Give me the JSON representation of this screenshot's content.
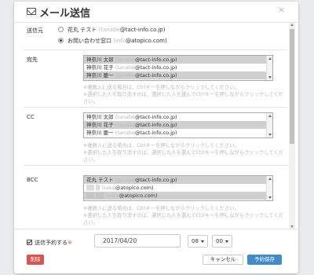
{
  "header": {
    "title": "メール送信",
    "close_glyph": "×"
  },
  "sender": {
    "label": "送信元",
    "options": [
      {
        "name": "花丸 テスト",
        "email_prefix": "(tanabe",
        "email_suffix": "@tact-info.co.jp)",
        "checked": false
      },
      {
        "name": "お問い合わせ窓口",
        "email_prefix": "(info",
        "email_suffix": "@atopico.com)",
        "checked": true
      }
    ]
  },
  "to": {
    "label": "宛先",
    "items": [
      {
        "name": "神奈川 太郎",
        "email_prefix": "(tanabe",
        "email_suffix": "@tact-info.co.jp)",
        "selected": true
      },
      {
        "name": "神奈川 花子",
        "email_prefix": "(tanabe",
        "email_suffix": "@tact-info.co.jp)",
        "selected": false
      },
      {
        "name": "神奈川 慶一",
        "email_prefix": "(tanabe",
        "email_suffix": "@tact-info.co.jp)",
        "selected": true
      }
    ],
    "hint1": "※複数人に送る場合は、Ctrlキーを押しながらクリックしてください。",
    "hint2": "※選択した人を取り消すのは、選択した人を選んでCtrlキーを押しながらクリックしてください。"
  },
  "cc": {
    "label": "CC",
    "items": [
      {
        "name": "神奈川 太郎",
        "email_prefix": "(tanabe",
        "email_suffix": "@tact-info.co.jp)",
        "selected": false
      },
      {
        "name": "神奈川 花子",
        "email_prefix": "(tanabe",
        "email_suffix": "@tact-info.co.jp)",
        "selected": true
      },
      {
        "name": "神奈川 慶一",
        "email_prefix": "(tanabe",
        "email_suffix": "@tact-info.co.jp)",
        "selected": false
      }
    ],
    "hint1": "※複数人に送る場合は、Ctrlキーを押しながらクリックしてください。",
    "hint2": "※選択した人を取り消すのは、選択した人を選んでCtrlキーを押しながらクリックしてください。"
  },
  "bcc": {
    "label": "BCC",
    "items": [
      {
        "name": "花丸 テスト",
        "email_prefix": "(tanabe",
        "email_suffix": "@tact-info.co.jp)",
        "selected": true
      },
      {
        "name": "",
        "email_prefix": "(saka",
        "email_suffix": "@atopico.com)",
        "selected": false
      },
      {
        "name": "",
        "email_prefix": "(saka",
        "email_suffix": "@atopico.com)",
        "selected": true
      }
    ],
    "hint1": "※複数人に送る場合は、Ctrlキーを押しながらクリックしてください。",
    "hint2": "※選択した人を取り消すのは、選択した人を選んでCtrlキーを押しながらクリックしてください。"
  },
  "schedule": {
    "label": "送信予約する",
    "required_mark": "※",
    "checked": true,
    "date": "2017/04/20",
    "hour": "08",
    "minute": "00"
  },
  "buttons": {
    "delete": "削除",
    "cancel": "キャンセル",
    "save": "予約保存"
  },
  "colors": {
    "delete": "#d9534f",
    "save": "#428bca"
  }
}
